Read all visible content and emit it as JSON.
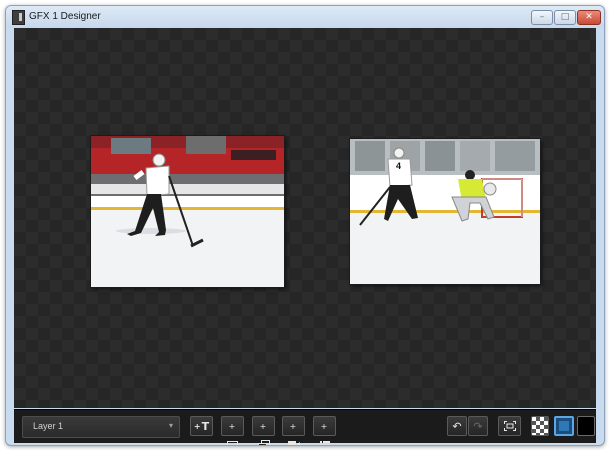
{
  "window": {
    "title": "GFX 1 Designer",
    "controls": {
      "minimize": "–",
      "maximize": "□",
      "close": "✕"
    }
  },
  "canvas": {
    "background": "checkerboard-dark",
    "photos": [
      {
        "subject": "hockey player skating with puck",
        "jersey_number": ""
      },
      {
        "subject": "hockey player shooting on goalie",
        "jersey_number": "4"
      }
    ]
  },
  "toolbar": {
    "layer_select": {
      "value": "Layer 1",
      "arrow": "▾"
    },
    "buttons": [
      {
        "name": "add-text-button",
        "icon": "T",
        "plus": "+"
      },
      {
        "name": "add-image-button",
        "icon": "image-icon",
        "plus": "+"
      },
      {
        "name": "add-gallery-button",
        "icon": "gallery-icon",
        "plus": "+"
      },
      {
        "name": "add-video-button",
        "icon": "video-camera-icon",
        "plus": "+"
      },
      {
        "name": "add-list-button",
        "icon": "list-icon",
        "plus": "+"
      }
    ],
    "undo_icon": "↶",
    "redo_icon": "↷",
    "background_options": [
      "transparent",
      "blue",
      "black"
    ],
    "active_background": "blue"
  },
  "colors": {
    "titlebar": "#c9dbee",
    "close_button": "#c64a36",
    "canvas": "#2c2c2c",
    "toolbar": "#1b1b1b",
    "selected_bg": "#1c4d7a",
    "selected_border": "#5aa6e6"
  }
}
